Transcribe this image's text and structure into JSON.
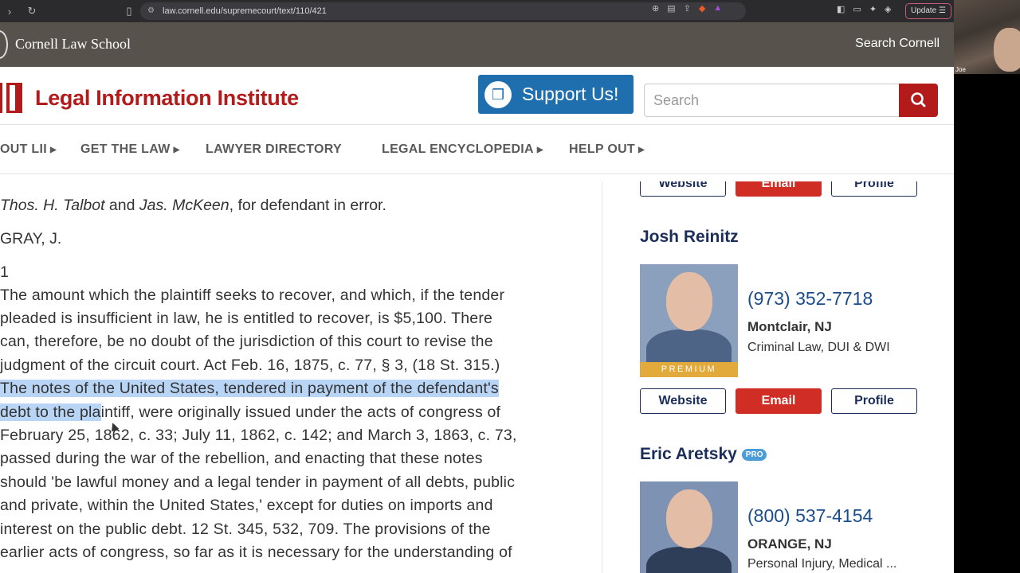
{
  "browser": {
    "url": "law.cornell.edu/supremecourt/text/110/421",
    "update_label": "Update"
  },
  "webcam": {
    "name": "Joe"
  },
  "cornell": {
    "name": "Cornell Law School",
    "search_link": "Search Cornell"
  },
  "header": {
    "title": "Legal Information Institute",
    "support_label": "Support Us!",
    "search_placeholder": "Search"
  },
  "nav": {
    "items": [
      {
        "label": "OUT LII",
        "dropdown": true
      },
      {
        "label": "GET THE LAW",
        "dropdown": true
      },
      {
        "label": "LAWYER DIRECTORY",
        "dropdown": false
      },
      {
        "label": "LEGAL ENCYCLOPEDIA",
        "dropdown": true
      },
      {
        "label": "HELP OUT",
        "dropdown": true
      }
    ]
  },
  "content": {
    "counsel": {
      "name1": "Thos. H. Talbot",
      "and": " and ",
      "name2": "Jas. McKeen",
      "rest": ", for defendant in error."
    },
    "judge": "GRAY, J.",
    "para_number": "1",
    "lines": [
      "The amount which the plaintiff seeks to recover, and which, if the tender",
      "pleaded is insufficient in law, he is entitled to recover, is $5,100. There",
      "can, therefore, be no doubt of the jurisdiction of this court to revise the",
      "judgment of the circuit court. Act Feb. 16, 1875, c. 77, § 3, (18 St. 315.)",
      "The notes of the United States, tendered in payment of the defendant's",
      "debt to the plaintiff, were originally issued under the acts of congress of",
      "February 25, 1862, c. 33; July 11, 1862, c. 142; and March 3, 1863, c. 73,",
      "passed during the war of the rebellion, and enacting that these notes",
      "should 'be lawful money and a legal tender in payment of all debts, public",
      "and private, within the United States,' except for duties on imports and",
      "interest on the public debt. 12 St. 345, 532, 709. The provisions of the",
      "earlier acts of congress, so far as it is necessary for the understanding of"
    ],
    "highlight_line4": "The notes of the United States, tendered in payment of the defendant's",
    "highlight_line5_sel": "debt to the pla",
    "highlight_line5_rest": "intiff, were originally issued under the acts of congress of"
  },
  "sidebar": {
    "top_buttons": {
      "website": "Website",
      "email": "Email",
      "profile": "Profile"
    },
    "attorneys": [
      {
        "name": "Josh Reinitz",
        "pro": false,
        "badge": "PREMIUM",
        "phone": "(973) 352-7718",
        "city": "Montclair, NJ",
        "practice": "Criminal Law, DUI & DWI",
        "website_label": "Website",
        "email_label": "Email",
        "profile_label": "Profile"
      },
      {
        "name": "Eric Aretsky",
        "pro": true,
        "pro_label": "PRO",
        "phone": "(800) 537-4154",
        "city": "ORANGE, NJ",
        "practice": "Personal Injury, Medical ..."
      }
    ]
  },
  "colors": {
    "brand_red": "#b31b1b",
    "support_blue": "#1f6ead",
    "navy": "#1b2e5a",
    "email_red": "#d02e25",
    "cornell_bar": "#57524c",
    "selection": "#b9d5f5"
  }
}
